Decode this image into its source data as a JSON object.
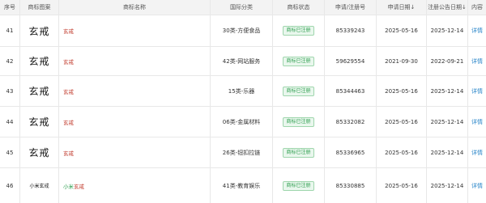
{
  "columns": {
    "index": "序号",
    "image": "商标图案",
    "name": "商标名称",
    "class": "国际分类",
    "status": "商标状态",
    "app_no": "申请/注册号",
    "app_date": "申请日期↓",
    "reg_date": "注册公告日期↓",
    "action": "内容"
  },
  "rows": [
    {
      "index": "41",
      "image": "玄戒",
      "name_prefix": "",
      "name": "玄戒",
      "class": "30类-方便食品",
      "status": "商标已注册",
      "app_no": "85339243",
      "app_date": "2025-05-16",
      "reg_date": "2025-12-14",
      "action": "详情"
    },
    {
      "index": "42",
      "image": "玄戒",
      "name_prefix": "",
      "name": "玄戒",
      "class": "42类-网站服务",
      "status": "商标已注册",
      "app_no": "59629554",
      "app_date": "2021-09-30",
      "reg_date": "2022-09-21",
      "action": "详情"
    },
    {
      "index": "43",
      "image": "玄戒",
      "name_prefix": "",
      "name": "玄戒",
      "class": "15类-乐器",
      "status": "商标已注册",
      "app_no": "85344463",
      "app_date": "2025-05-16",
      "reg_date": "2025-12-14",
      "action": "详情"
    },
    {
      "index": "44",
      "image": "玄戒",
      "name_prefix": "",
      "name": "玄戒",
      "class": "06类-金属材料",
      "status": "商标已注册",
      "app_no": "85332082",
      "app_date": "2025-05-16",
      "reg_date": "2025-12-14",
      "action": "详情"
    },
    {
      "index": "45",
      "image": "玄戒",
      "name_prefix": "",
      "name": "玄戒",
      "class": "26类-钮扣拉链",
      "status": "商标已注册",
      "app_no": "85336965",
      "app_date": "2025-05-16",
      "reg_date": "2025-12-14",
      "action": "详情"
    },
    {
      "index": "46",
      "image": "小米玄戒",
      "name_prefix": "小米",
      "name": "玄戒",
      "class": "41类-教育娱乐",
      "status": "商标已注册",
      "app_no": "85330885",
      "app_date": "2025-05-16",
      "reg_date": "2025-12-14",
      "action": "详情"
    }
  ]
}
